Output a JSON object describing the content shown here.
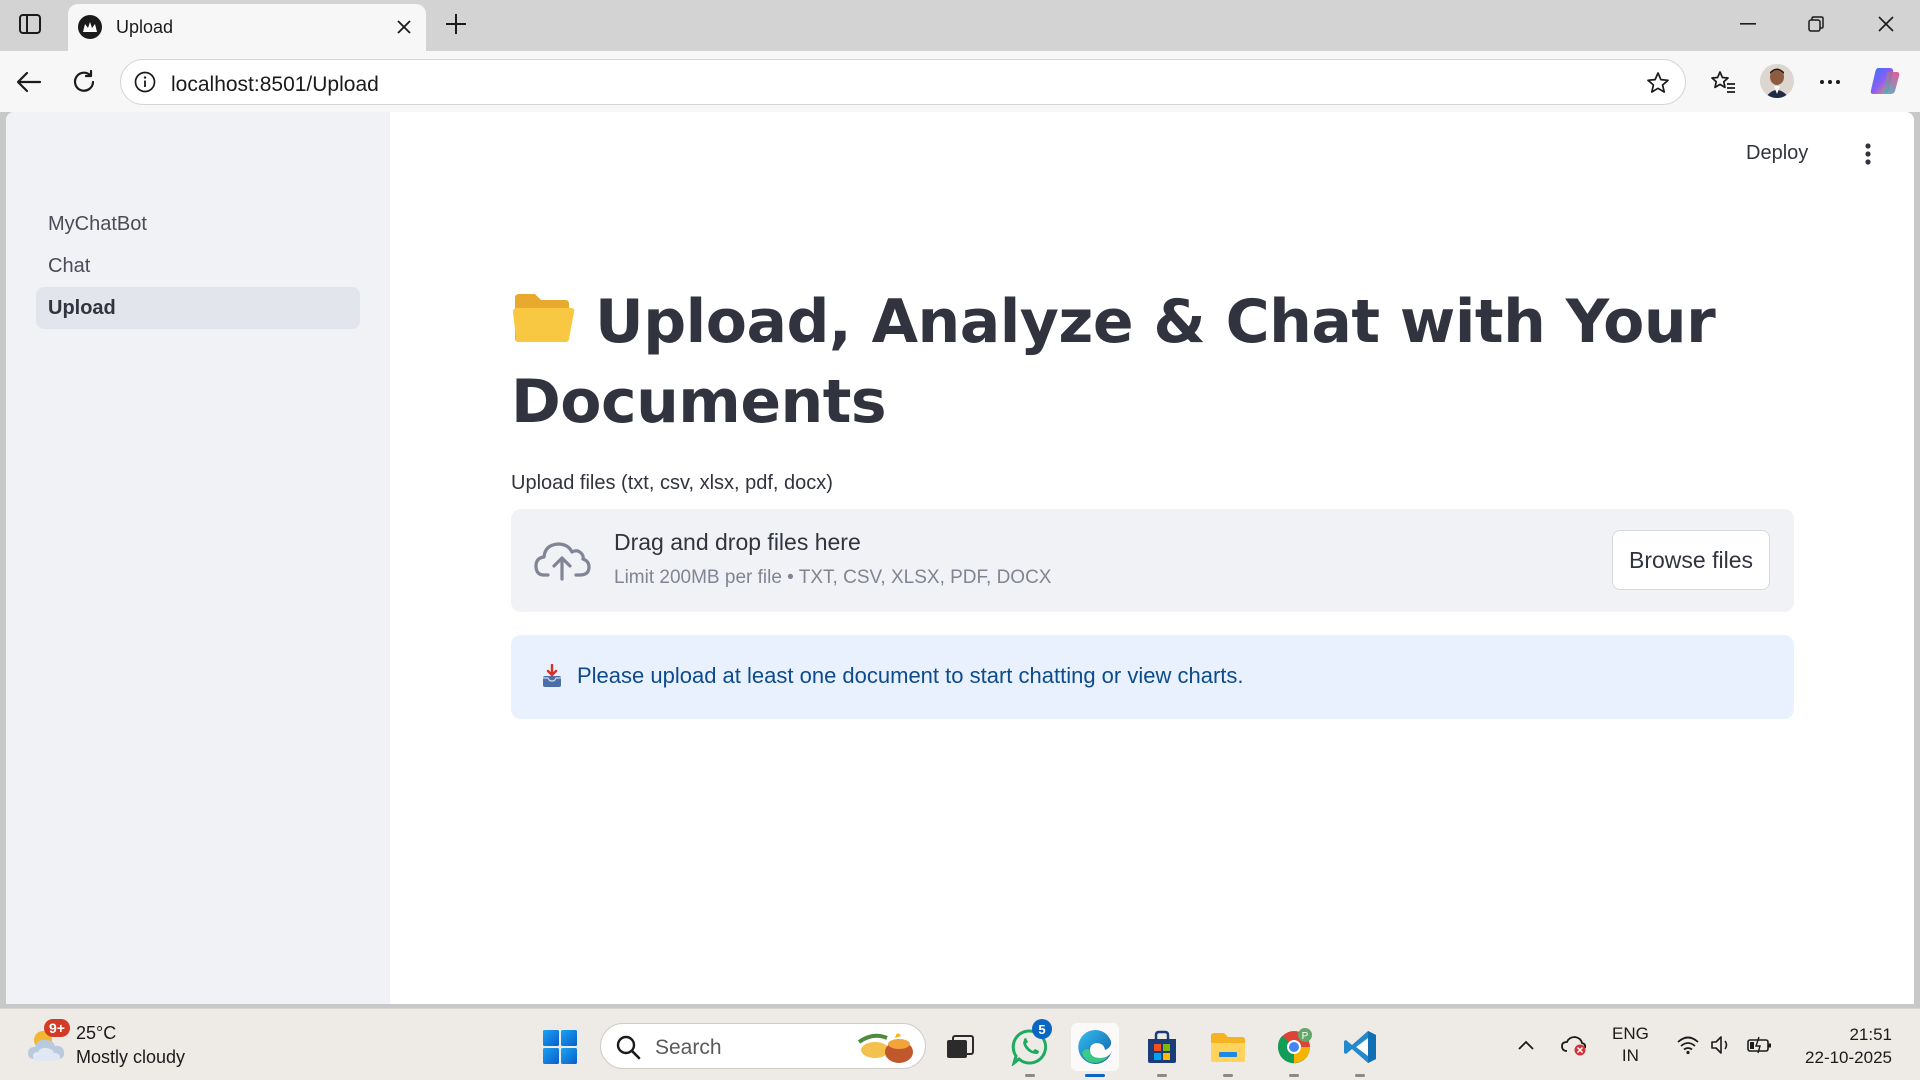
{
  "browser": {
    "tab_title": "Upload",
    "url": "localhost:8501/Upload"
  },
  "app": {
    "deploy_label": "Deploy",
    "sidebar": {
      "items": [
        {
          "label": "MyChatBot",
          "active": false
        },
        {
          "label": "Chat",
          "active": false
        },
        {
          "label": "Upload",
          "active": true
        }
      ]
    },
    "page_title": "Upload, Analyze & Chat with Your Documents",
    "uploader": {
      "label": "Upload files (txt, csv, xlsx, pdf, docx)",
      "drop_text": "Drag and drop files here",
      "limit_text": "Limit 200MB per file • TXT, CSV, XLSX, PDF, DOCX",
      "browse_label": "Browse files"
    },
    "info_message": "Please upload at least one document to start chatting or view charts."
  },
  "taskbar": {
    "weather": {
      "badge": "9+",
      "temperature": "25°C",
      "condition": "Mostly cloudy"
    },
    "search_placeholder": "Search",
    "whatsapp_badge": "5",
    "language": {
      "line1": "ENG",
      "line2": "IN"
    },
    "clock": {
      "time": "21:51",
      "date": "22-10-2025"
    }
  },
  "colors": {
    "sidebar_bg": "#f0f2f6",
    "text_primary": "#31333f",
    "info_bg": "#e8f1fd",
    "info_text": "#0d4b8c",
    "accent_blue": "#0b66c2"
  }
}
